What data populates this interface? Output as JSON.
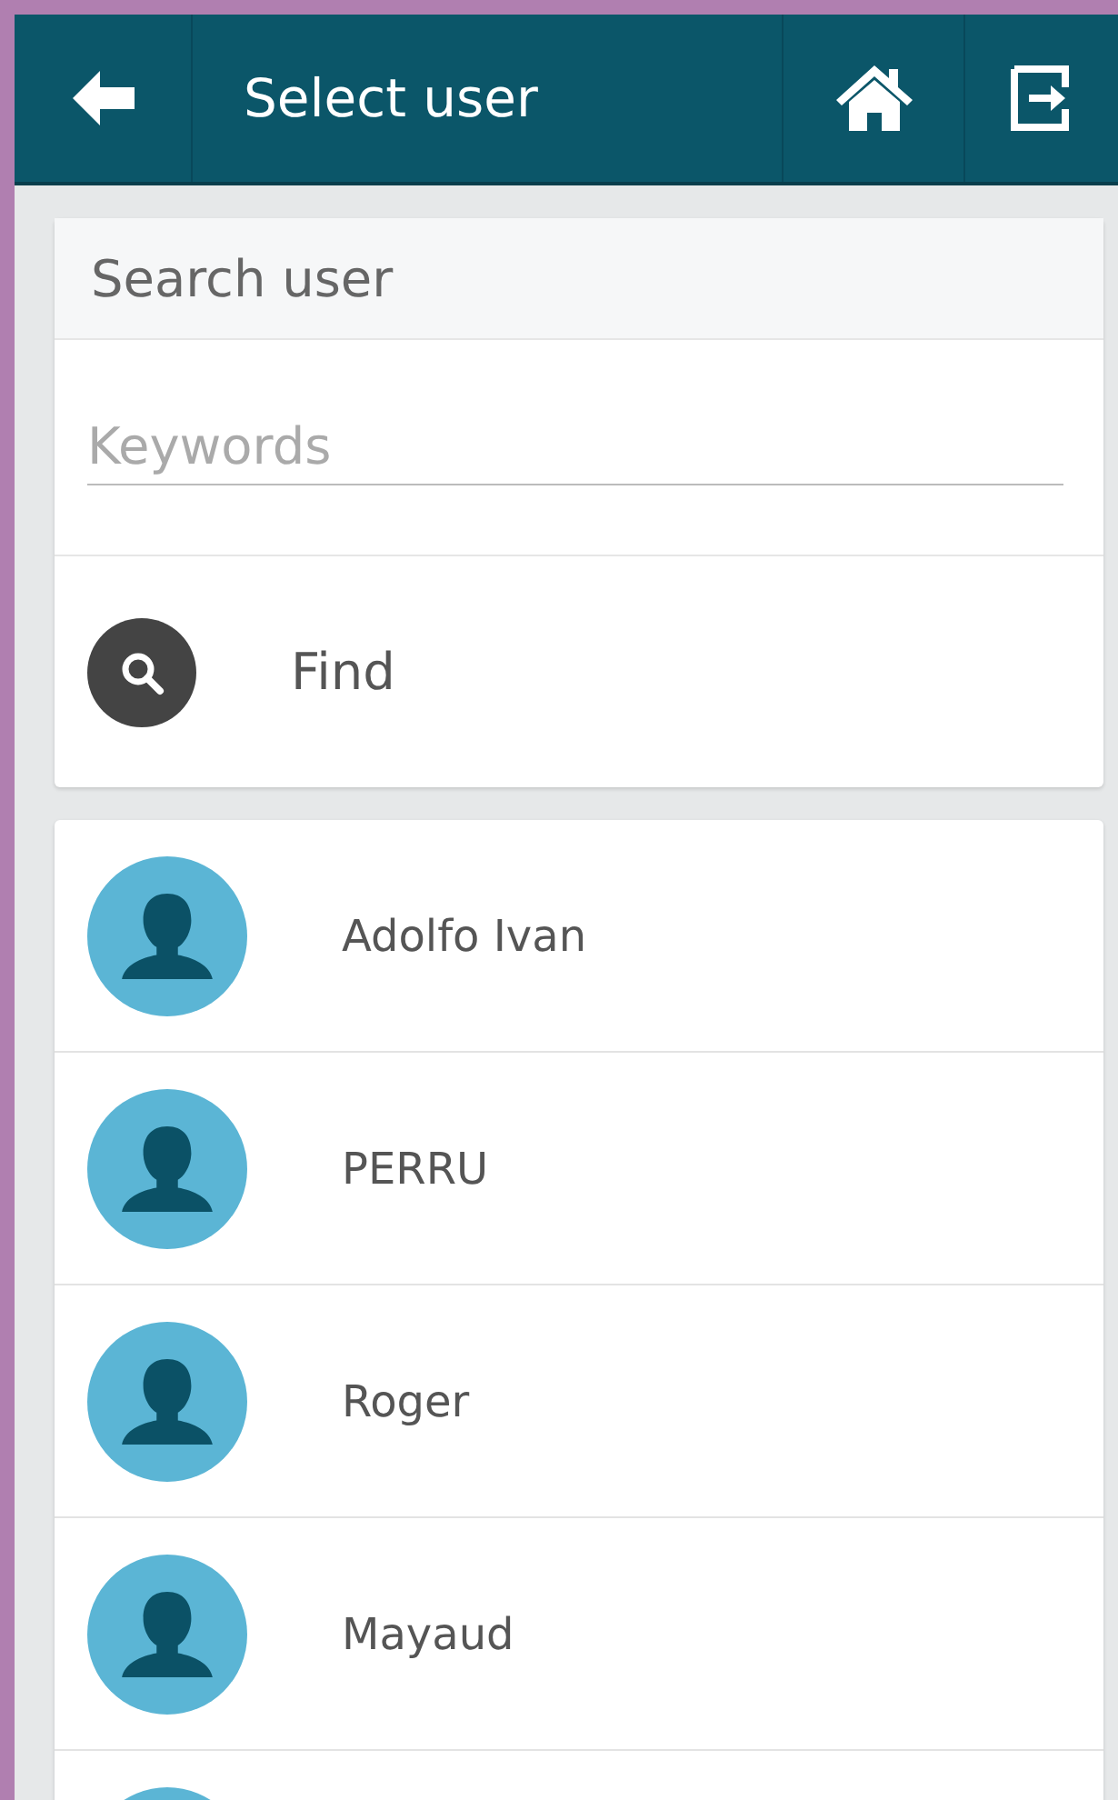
{
  "app_bar": {
    "title": "Select user"
  },
  "search": {
    "heading": "Search user",
    "placeholder": "Keywords",
    "find_label": "Find"
  },
  "users": [
    {
      "name": "Adolfo Ivan"
    },
    {
      "name": "PERRU"
    },
    {
      "name": "Roger"
    },
    {
      "name": "Mayaud"
    }
  ]
}
